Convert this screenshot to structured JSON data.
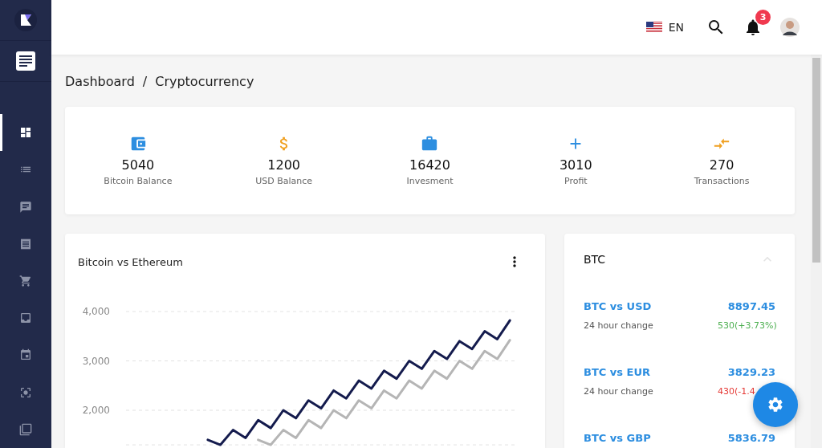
{
  "sidebar": {
    "items": [
      {
        "selected": true
      },
      {
        "selected": false
      },
      {
        "selected": false
      },
      {
        "selected": false
      },
      {
        "selected": false
      },
      {
        "selected": false
      },
      {
        "selected": false
      },
      {
        "selected": false
      },
      {
        "selected": false
      }
    ]
  },
  "topbar": {
    "language": "EN",
    "notifications": "3"
  },
  "breadcrumb": {
    "items": [
      "Dashboard",
      "Cryptocurrency"
    ],
    "separator": "/"
  },
  "stats": [
    {
      "value": "5040",
      "label": "Bitcoin Balance"
    },
    {
      "value": "1200",
      "label": "USD Balance"
    },
    {
      "value": "16420",
      "label": "Invesment"
    },
    {
      "value": "3010",
      "label": "Profit"
    },
    {
      "value": "270",
      "label": "Transactions"
    }
  ],
  "chart_card": {
    "title": "Bitcoin vs Ethereum",
    "chart_data": {
      "type": "line",
      "categories": [
        null,
        null,
        null,
        null,
        null,
        null,
        null,
        null,
        null,
        null,
        null,
        null,
        null,
        null,
        null,
        null,
        null,
        null,
        null,
        null,
        null,
        null,
        null,
        null,
        null,
        null,
        null,
        null,
        null,
        null,
        null
      ],
      "grid": true,
      "ylim": [
        1300,
        4000
      ],
      "yticks": [
        {
          "value": 2000,
          "label": "2,000"
        },
        {
          "value": 3000,
          "label": "3,000"
        },
        {
          "value": 4000,
          "label": "4,000"
        }
      ],
      "series": [
        {
          "color": "#141b4d",
          "values": [
            null,
            null,
            null,
            null,
            null,
            null,
            1400,
            1300,
            1600,
            1440,
            1800,
            1640,
            2000,
            1840,
            2200,
            2040,
            2400,
            2240,
            2600,
            2440,
            2800,
            2640,
            3000,
            2840,
            3200,
            3040,
            3400,
            3240,
            3600,
            3440,
            3820
          ]
        },
        {
          "color": "#b5b5b5",
          "values": [
            null,
            null,
            null,
            null,
            null,
            null,
            null,
            null,
            null,
            null,
            1400,
            1300,
            1600,
            1440,
            1800,
            1640,
            2000,
            1840,
            2200,
            2040,
            2400,
            2240,
            2600,
            2440,
            2800,
            2640,
            3000,
            2840,
            3200,
            3040,
            3420
          ]
        }
      ]
    }
  },
  "btc_card": {
    "title": "BTC",
    "rows": [
      {
        "pair": "BTC vs USD",
        "price": "8897.45",
        "caption": "24 hour change",
        "change": "530(+3.73%)",
        "color": "#4caf50"
      },
      {
        "pair": "BTC vs EUR",
        "price": "3829.23",
        "caption": "24 hour change",
        "change": "430(-1.4",
        "color": "#e53935"
      },
      {
        "pair": "BTC vs GBP",
        "price": "5836.79"
      }
    ]
  }
}
